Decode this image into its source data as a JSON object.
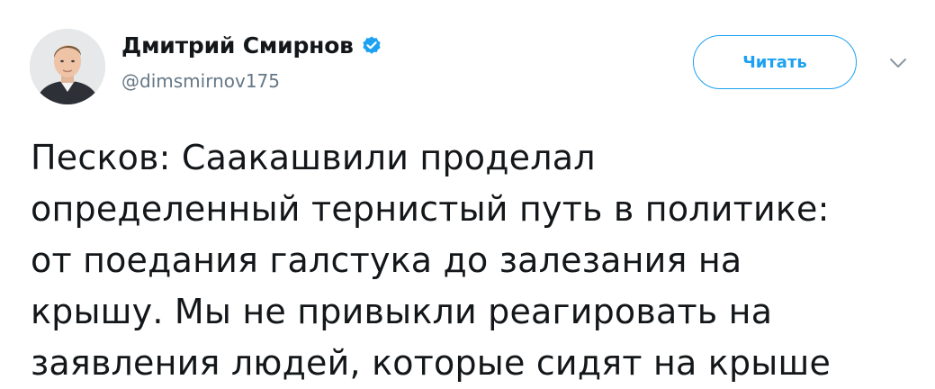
{
  "author": {
    "display_name": "Дмитрий Смирнов",
    "handle": "@dimsmirnov175",
    "verified": true,
    "avatar_icon": "avatar-photo"
  },
  "actions": {
    "follow_label": "Читать",
    "menu_icon": "chevron-down-icon"
  },
  "tweet": {
    "text": "Песков: Саакашвили проделал\nопределенный тернистый путь в политике:\nот поедания галстука до залезания на\nкрышу. Мы не привыкли реагировать на\nзаявления людей, которые сидят на крыше"
  },
  "colors": {
    "accent": "#1da1f2",
    "text": "#14171a",
    "secondary": "#657786"
  }
}
